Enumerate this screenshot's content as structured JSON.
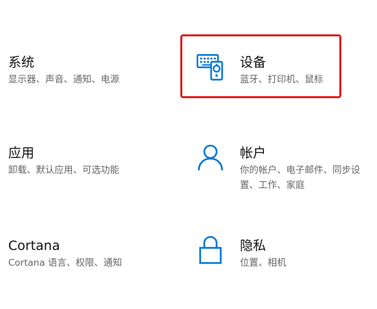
{
  "settings": {
    "tiles": [
      {
        "title": "系统",
        "desc": "显示器、声音、通知、电源",
        "icon": "none"
      },
      {
        "title": "设备",
        "desc": "蓝牙、打印机、鼠标",
        "icon": "devices-icon"
      },
      {
        "title": "应用",
        "desc": "卸载、默认应用、可选功能",
        "icon": "none"
      },
      {
        "title": "帐户",
        "desc_line1": "你的帐户、电子邮件、同步设",
        "desc_line2": "置、工作、家庭",
        "icon": "person-icon"
      },
      {
        "title": "Cortana",
        "desc": "Cortana 语言、权限、通知",
        "icon": "none"
      },
      {
        "title": "隐私",
        "desc": "位置、相机",
        "icon": "lock-icon"
      }
    ]
  },
  "colors": {
    "accent": "#0078d7",
    "highlight": "#e02020",
    "title_text": "#111111",
    "desc_text": "#666666"
  }
}
